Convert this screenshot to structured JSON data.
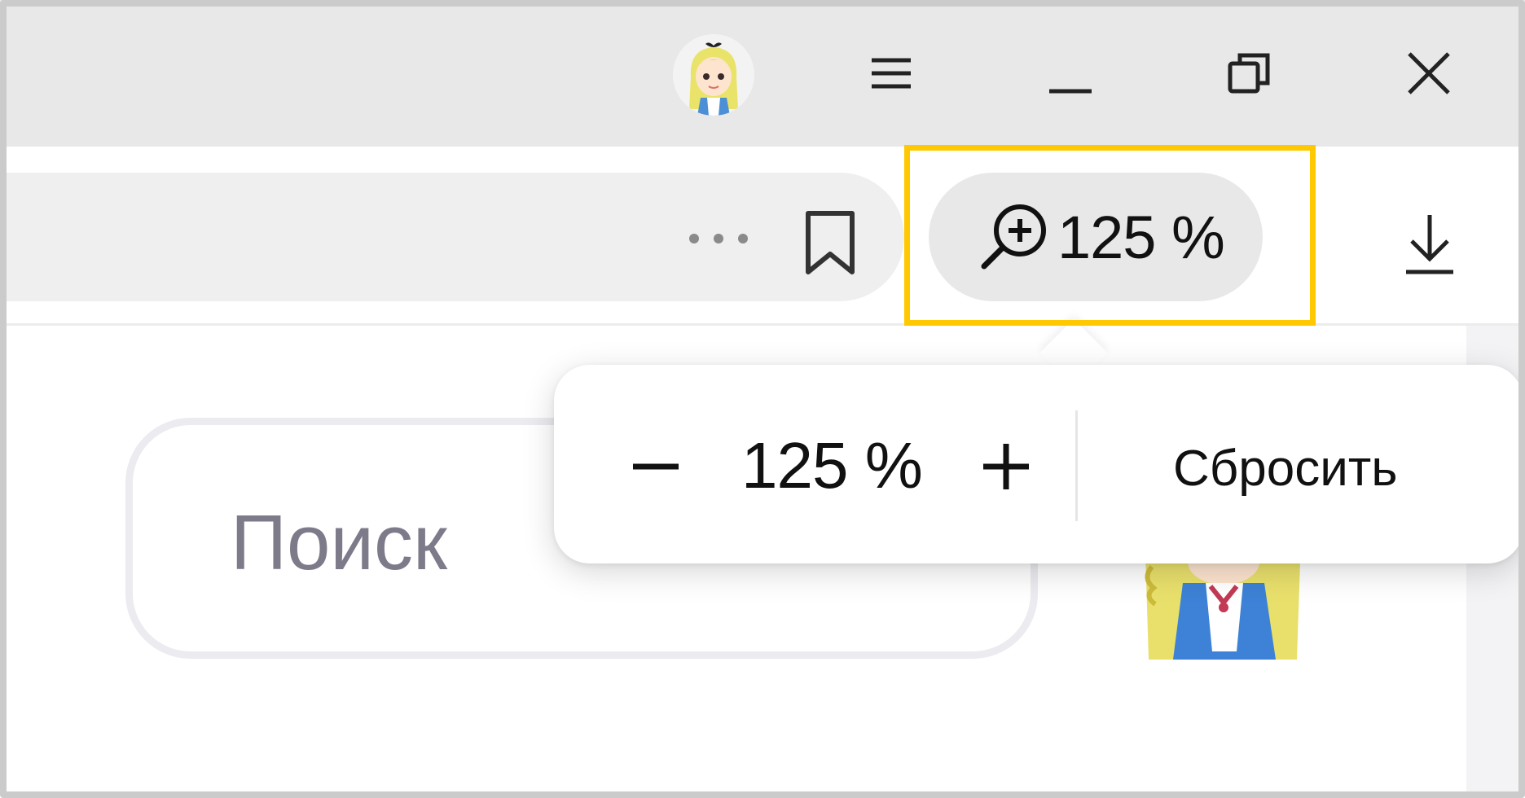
{
  "window_controls": {
    "avatar": "profile-avatar",
    "menu_icon": "hamburger-menu-icon",
    "minimize_icon": "minimize-icon",
    "restore_icon": "restore-icon",
    "close_icon": "close-icon"
  },
  "toolbar": {
    "more_icon": "more-dots-icon",
    "bookmark_icon": "bookmark-icon",
    "zoom_value": "125 %",
    "zoom_icon": "zoom-in-icon",
    "download_icon": "download-icon",
    "highlight_color": "#ffc800"
  },
  "search": {
    "placeholder": "Поиск",
    "icon": "search-icon"
  },
  "zoom_popup": {
    "decrease_label": "−",
    "value": "125 %",
    "increase_label": "+",
    "reset_label": "Сбросить"
  }
}
